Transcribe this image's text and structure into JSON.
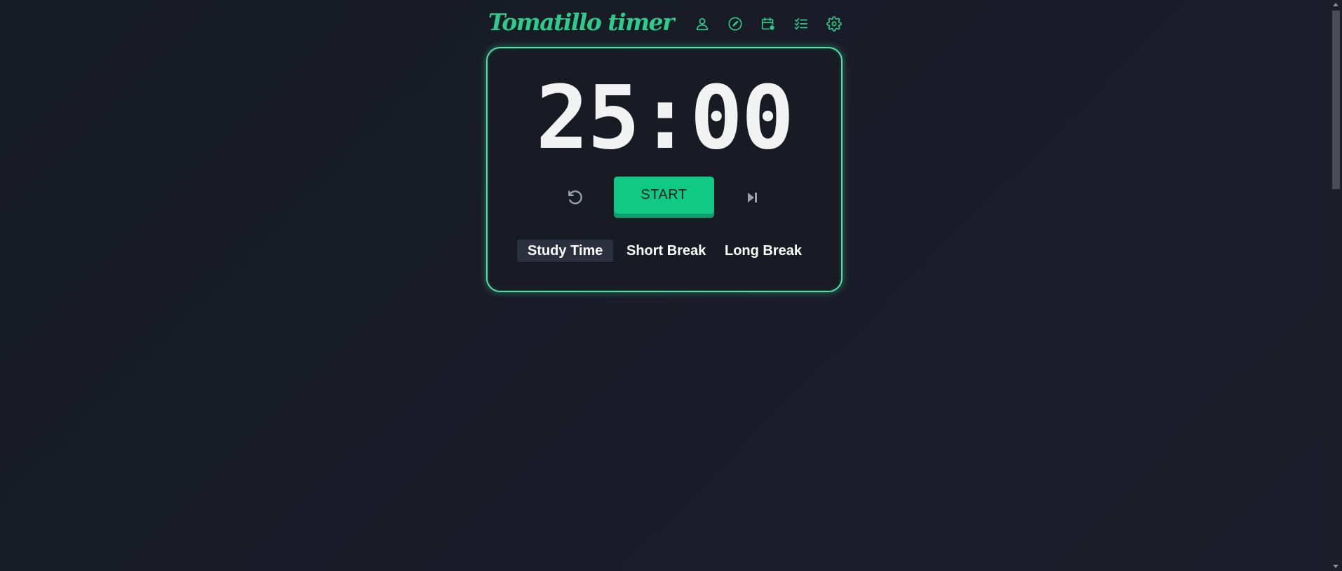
{
  "app": {
    "title": "Tomatillo timer"
  },
  "nav": {
    "icons": [
      "user-icon",
      "compass-icon",
      "calendar-icon",
      "checklist-icon",
      "gear-icon"
    ]
  },
  "timer": {
    "time": "25:00",
    "start_label": "START"
  },
  "modes": [
    {
      "label": "Study Time",
      "active": true
    },
    {
      "label": "Short Break",
      "active": false
    },
    {
      "label": "Long Break",
      "active": false
    }
  ],
  "colors": {
    "accent": "#2ecc8a",
    "start_button": "#10c985",
    "background": "#181b24",
    "active_tab": "#2c2f3d"
  }
}
